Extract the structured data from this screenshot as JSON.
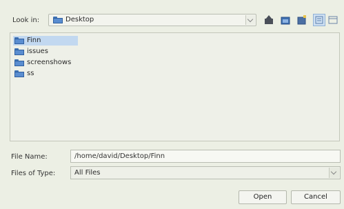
{
  "look_in": {
    "label": "Look in:",
    "value": "Desktop"
  },
  "toolbar": {
    "icons": [
      "up-folder-icon",
      "home-icon",
      "new-folder-icon",
      "list-view-icon",
      "details-view-icon"
    ]
  },
  "files": [
    {
      "name": "Finn",
      "selected": true
    },
    {
      "name": "issues",
      "selected": false
    },
    {
      "name": "screenshows",
      "selected": false
    },
    {
      "name": "ss",
      "selected": false
    }
  ],
  "file_name": {
    "label": "File Name:",
    "value": "/home/david/Desktop/Finn"
  },
  "file_type": {
    "label": "Files of Type:",
    "value": "All Files"
  },
  "buttons": {
    "open": "Open",
    "cancel": "Cancel"
  },
  "colors": {
    "selection": "#c2d8f0",
    "folder": "#5a8dd0",
    "background": "#ecefe4"
  }
}
